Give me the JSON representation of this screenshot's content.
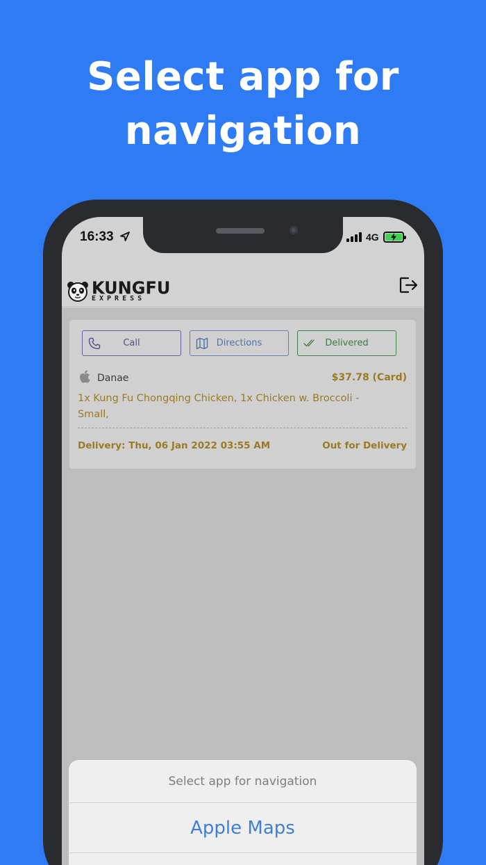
{
  "headline": {
    "line1": "Select app for",
    "line2": "navigation"
  },
  "status_bar": {
    "time": "16:33",
    "network": "4G",
    "battery_color": "#3fd251"
  },
  "app_bar": {
    "logo_main": "KUNGFU",
    "logo_sub": "EXPRESS",
    "logout_icon": "logout-icon"
  },
  "order": {
    "actions": {
      "call": "Call",
      "directions": "Directions",
      "delivered": "Delivered"
    },
    "customer_name": "Danae",
    "price": "$37.78 (Card)",
    "items": "1x Kung Fu Chongqing Chicken, 1x Chicken w. Broccoli - Small,",
    "delivery": "Delivery: Thu, 06 Jan 2022 03:55 AM",
    "status": "Out for Delivery"
  },
  "action_sheet": {
    "title": "Select app for navigation",
    "options": [
      "Apple Maps"
    ]
  },
  "colors": {
    "background": "#2f7bf3",
    "accent_gold": "#9a7a22",
    "link_blue": "#3f7fd4"
  }
}
